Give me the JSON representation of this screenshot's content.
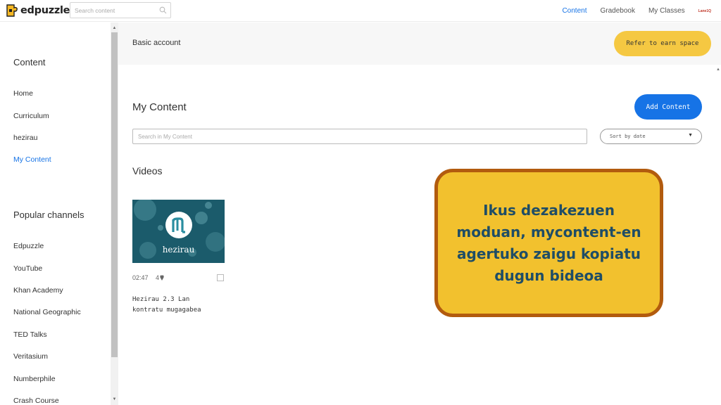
{
  "app": {
    "logo_text": "edpuzzle"
  },
  "topbar": {
    "search_placeholder": "Search content",
    "nav": {
      "content": "Content",
      "gradebook": "Gradebook",
      "my_classes": "My Classes",
      "user": "Lane1Q"
    }
  },
  "sidebar": {
    "content_heading": "Content",
    "content_items": [
      "Home",
      "Curriculum",
      "hezirau",
      "My Content"
    ],
    "active_item": "My Content",
    "channels_heading": "Popular channels",
    "channels": [
      "Edpuzzle",
      "YouTube",
      "Khan Academy",
      "National Geographic",
      "TED Talks",
      "Veritasium",
      "Numberphile",
      "Crash Course"
    ]
  },
  "subheader": {
    "account_label": "Basic account",
    "refer_button": "Refer to earn space"
  },
  "main": {
    "title": "My Content",
    "add_button": "Add Content",
    "search_placeholder": "Search in My Content",
    "sort_label": "Sort by date",
    "videos_heading": "Videos",
    "video": {
      "thumbnail_caption": "hezirau",
      "duration": "02:47",
      "likes": "4",
      "title_line1": "Hezirau 2.3 Lan",
      "title_line2": "kontratu mugagabea"
    }
  },
  "callout": {
    "text": "Ikus dezakezuen moduan, mycontent-en agertuko zaigu kopiatu dugun bideoa"
  },
  "colors": {
    "accent_blue": "#1673e6",
    "refer_yellow": "#f5c842",
    "callout_fill": "#f2c12e",
    "callout_border": "#b25b0e",
    "callout_text": "#1f4d66",
    "thumbnail_bg": "#1b5b6b"
  }
}
